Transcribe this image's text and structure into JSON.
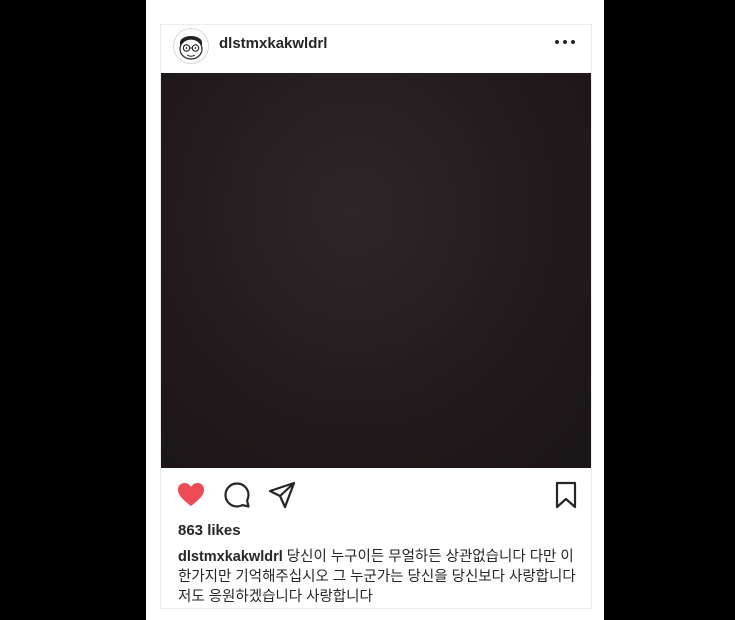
{
  "post": {
    "username": "dlstmxkakwldrl",
    "likes_text": "863 likes",
    "liked": true,
    "accent_like_color": "#ed4956",
    "caption_username": "dlstmxkakwldrl",
    "caption_text": "당신이 누구이든 무얼하든 상관없습니다 다만 이 한가지만 기억해주십시오 그 누군가는 당신을 당신보다 사랑합니다 저도 응원하겠습니다 사랑합니다"
  },
  "icons": {
    "avatar": "cartoon-avatar",
    "more": "more-options-icon",
    "like": "heart-icon",
    "comment": "comment-icon",
    "share": "send-icon",
    "save": "bookmark-icon"
  }
}
